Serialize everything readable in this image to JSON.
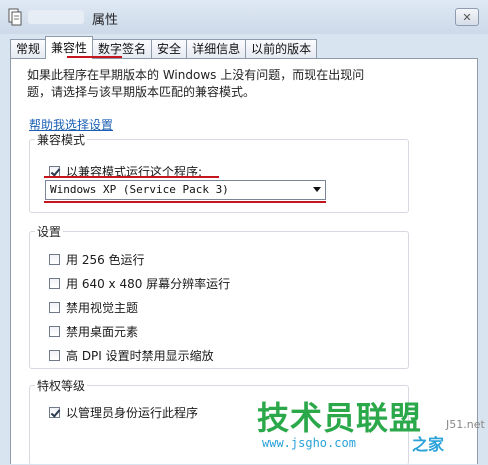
{
  "window": {
    "title": "属性",
    "close_symbol": "✕"
  },
  "tabs": [
    {
      "label": "常规",
      "active": false
    },
    {
      "label": "兼容性",
      "active": true
    },
    {
      "label": "数字签名",
      "active": false
    },
    {
      "label": "安全",
      "active": false
    },
    {
      "label": "详细信息",
      "active": false
    },
    {
      "label": "以前的版本",
      "active": false
    }
  ],
  "compat": {
    "description_line1": "如果此程序在早期版本的 Windows 上没有问题，而现在出现问",
    "description_line2": "题，请选择与该早期版本匹配的兼容模式。",
    "help_link": "帮助我选择设置",
    "mode_group_label": "兼容模式",
    "mode_checkbox_label": "以兼容模式运行这个程序:",
    "mode_checked": true,
    "mode_selected": "Windows XP (Service Pack 3)",
    "settings_group_label": "设置",
    "settings": [
      {
        "label": "用 256 色运行",
        "checked": false
      },
      {
        "label": "用 640 x 480 屏幕分辨率运行",
        "checked": false
      },
      {
        "label": "禁用视觉主题",
        "checked": false
      },
      {
        "label": "禁用桌面元素",
        "checked": false
      },
      {
        "label": "高 DPI 设置时禁用显示缩放",
        "checked": false
      }
    ],
    "privilege_group_label": "特权等级",
    "privilege_checkbox_label": "以管理员身份运行此程序",
    "privilege_checked": true
  },
  "watermark": {
    "brand": "技术员联盟",
    "url": "www.jsgho.com",
    "tail": "之家",
    "site_fragment": "J51.net"
  },
  "colors": {
    "accent_red": "#c4161c",
    "link_blue": "#1a5fb4",
    "watermark_green": "#2ba84a"
  }
}
